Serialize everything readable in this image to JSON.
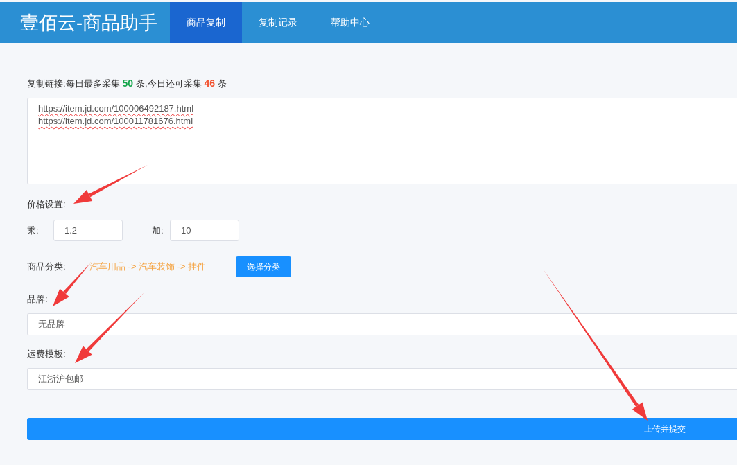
{
  "header": {
    "title": "壹佰云-商品助手",
    "tabs": [
      {
        "label": "商品复制",
        "selected": true
      },
      {
        "label": "复制记录",
        "selected": false
      },
      {
        "label": "帮助中心",
        "selected": false
      }
    ]
  },
  "links": {
    "label_start": "复制链接:每日最多采集",
    "max_count": "50",
    "label_middle": "条,今日还可采集",
    "remaining_count": "46",
    "label_end": "条",
    "value": [
      "https://item.jd.com/100006492187.html",
      "https://item.jd.com/100011781676.html"
    ]
  },
  "price": {
    "label": "价格设置:",
    "multiply_label": "乘:",
    "multiply_value": "1.2",
    "add_label": "加:",
    "add_value": "10"
  },
  "category": {
    "label": "商品分类:",
    "path": "汽车用品 -> 汽车装饰 -> 挂件",
    "button": "选择分类"
  },
  "brand": {
    "label": "品牌:",
    "value": "无品牌"
  },
  "shipping": {
    "label": "运费模板:",
    "value": "江浙沪包邮"
  },
  "submit": "上传并提交"
}
